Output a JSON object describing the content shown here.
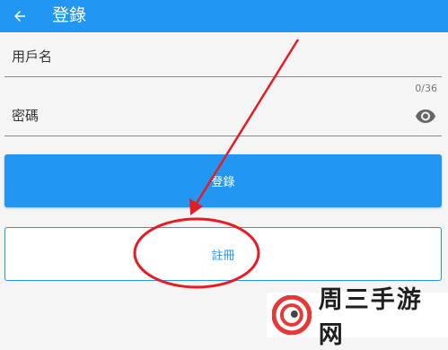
{
  "appbar": {
    "title": "登錄",
    "back_icon": "arrow-left-icon"
  },
  "form": {
    "username_label": "用戶名",
    "password_label": "密碼",
    "password_counter": "0/36",
    "visibility_icon": "eye-icon"
  },
  "buttons": {
    "login_label": "登錄",
    "register_label": "註冊"
  },
  "colors": {
    "primary": "#2196f3",
    "annotation": "#e51c23"
  },
  "watermark": {
    "text": "周三手游网"
  }
}
